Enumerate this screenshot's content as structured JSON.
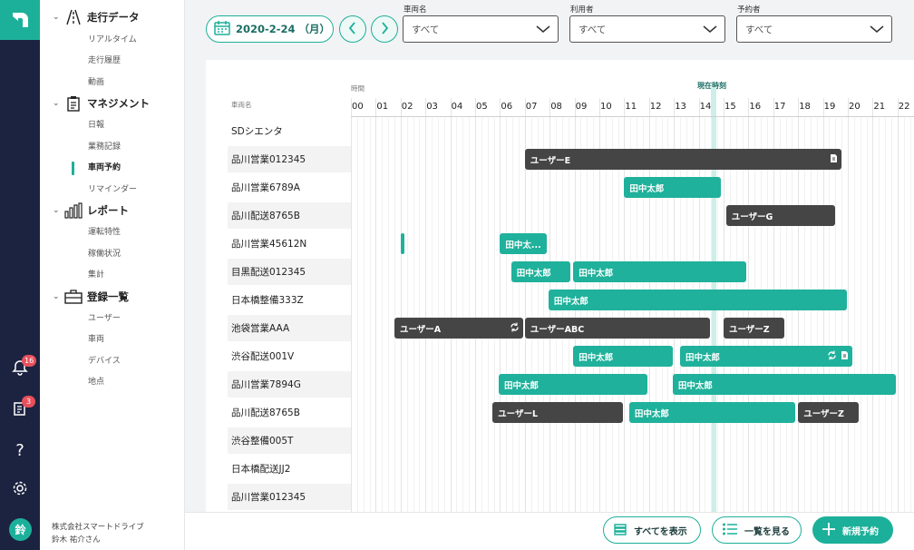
{
  "rail": {
    "logo": "app-logo",
    "notifications": {
      "icon": "bell-icon",
      "badge": "16"
    },
    "documents": {
      "icon": "documents-icon",
      "badge": "3"
    },
    "help_icon": "question-icon",
    "settings_icon": "gear-icon",
    "avatar": "鈴"
  },
  "sidebar": {
    "sections": [
      {
        "label": "走行データ",
        "icon": "road-icon",
        "items": [
          "リアルタイム",
          "走行履歴",
          "動画"
        ]
      },
      {
        "label": "マネジメント",
        "icon": "clipboard-icon",
        "items": [
          "日報",
          "業務記録",
          "車両予約",
          "リマインダー"
        ]
      },
      {
        "label": "レポート",
        "icon": "bar-chart-icon",
        "items": [
          "運転特性",
          "稼働状況",
          "集計"
        ]
      },
      {
        "label": "登録一覧",
        "icon": "briefcase-icon",
        "items": [
          "ユーザー",
          "車両",
          "デバイス",
          "地点"
        ]
      }
    ],
    "active_item": "車両予約",
    "company": "株式会社スマートドライブ",
    "user": "鈴木 祐介さん"
  },
  "toolbar": {
    "date": "2020-2-24 （月）",
    "filters": [
      {
        "label": "車両名",
        "value": "すべて"
      },
      {
        "label": "利用者",
        "value": "すべて"
      },
      {
        "label": "予約者",
        "value": "すべて"
      }
    ]
  },
  "schedule": {
    "vehicle_header": "車両名",
    "time_header": "時間",
    "now_label": "現在時刻",
    "now_time": "14:40",
    "hours": [
      "00",
      "01",
      "02",
      "03",
      "04",
      "05",
      "06",
      "07",
      "08",
      "09",
      "10",
      "11",
      "12",
      "13",
      "14",
      "15",
      "16",
      "17",
      "18",
      "19",
      "20",
      "21",
      "22"
    ],
    "vehicles": [
      "SDシエンタ",
      "品川営業012345",
      "品川営業6789A",
      "品川配送8765B",
      "品川営業45612N",
      "目黒配送012345",
      "日本橋整備333Z",
      "池袋営業AAA",
      "渋谷配送001V",
      "品川営業7894G",
      "品川配送8765B",
      "渋谷整備005T",
      "日本橋配送JJ2",
      "品川営業012345"
    ],
    "reservations": [
      {
        "row": 1,
        "start": 7.0,
        "end": 19.75,
        "user": "ユーザーE",
        "type": "dark",
        "icons": [
          "document-icon"
        ]
      },
      {
        "row": 2,
        "start": 11.0,
        "end": 14.9,
        "user": "田中太郎",
        "type": "teal",
        "icons": []
      },
      {
        "row": 3,
        "start": 15.1,
        "end": 19.5,
        "user": "ユーザーG",
        "type": "dark",
        "icons": []
      },
      {
        "row": 4,
        "start": 2.0,
        "end": 2.15,
        "user": "",
        "type": "teal",
        "icons": []
      },
      {
        "row": 4,
        "start": 6.0,
        "end": 7.9,
        "user": "田中太...",
        "type": "teal",
        "icons": []
      },
      {
        "row": 5,
        "start": 6.45,
        "end": 8.85,
        "user": "田中太郎",
        "type": "teal",
        "icons": []
      },
      {
        "row": 5,
        "start": 8.95,
        "end": 15.9,
        "user": "田中太郎",
        "type": "teal",
        "icons": []
      },
      {
        "row": 6,
        "start": 7.95,
        "end": 19.95,
        "user": "田中太郎",
        "type": "teal",
        "icons": []
      },
      {
        "row": 7,
        "start": 1.75,
        "end": 6.95,
        "user": "ユーザーA",
        "type": "dark",
        "icons": [
          "sync-icon"
        ]
      },
      {
        "row": 7,
        "start": 7.0,
        "end": 14.45,
        "user": "ユーザーABC",
        "type": "dark",
        "icons": []
      },
      {
        "row": 7,
        "start": 15.0,
        "end": 17.45,
        "user": "ユーザーZ",
        "type": "dark",
        "icons": []
      },
      {
        "row": 8,
        "start": 8.95,
        "end": 12.95,
        "user": "田中太郎",
        "type": "teal",
        "icons": []
      },
      {
        "row": 8,
        "start": 13.25,
        "end": 20.2,
        "user": "田中太郎",
        "type": "teal",
        "icons": [
          "sync-icon",
          "document-icon"
        ]
      },
      {
        "row": 9,
        "start": 5.95,
        "end": 11.95,
        "user": "田中太郎",
        "type": "teal",
        "icons": []
      },
      {
        "row": 9,
        "start": 12.95,
        "end": 21.95,
        "user": "田中太郎",
        "type": "teal",
        "icons": []
      },
      {
        "row": 10,
        "start": 5.7,
        "end": 10.95,
        "user": "ユーザーL",
        "type": "dark",
        "icons": []
      },
      {
        "row": 10,
        "start": 11.2,
        "end": 17.9,
        "user": "田中太郎",
        "type": "teal",
        "icons": []
      },
      {
        "row": 10,
        "start": 18.0,
        "end": 20.45,
        "user": "ユーザーZ",
        "type": "dark",
        "icons": []
      }
    ]
  },
  "footer": {
    "show_all": "すべてを表示",
    "view_list": "一覧を見る",
    "new_reservation": "新規予約"
  },
  "colors": {
    "accent": "#1cb09a",
    "dark_bar": "#454545",
    "rail": "#1c2340"
  }
}
